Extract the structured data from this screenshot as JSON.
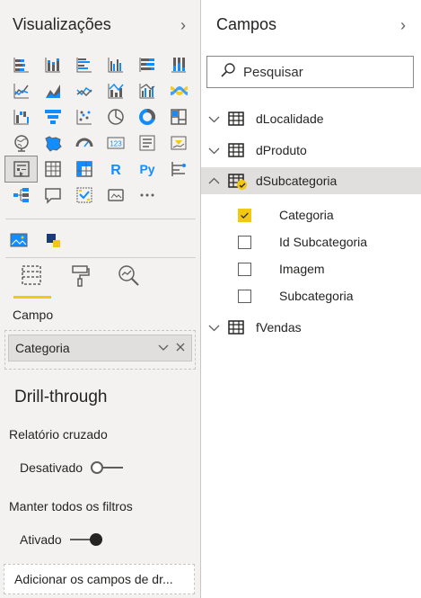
{
  "visualizations": {
    "title": "Visualizações",
    "tabs": [
      {
        "name": "fields-tab",
        "icon": "fields-well-icon"
      },
      {
        "name": "format-tab",
        "icon": "paint-roller-icon"
      },
      {
        "name": "analytics-tab",
        "icon": "analytics-magnifier-icon"
      }
    ],
    "field_section_label": "Campo",
    "field_value": "Categoria",
    "drillthrough": {
      "title": "Drill-through",
      "cross_report_label": "Relatório cruzado",
      "cross_report_state": "Desativado",
      "keep_filters_label": "Manter todos os filtros",
      "keep_filters_state": "Ativado",
      "add_fields_label": "Adicionar os campos de dr..."
    },
    "accent_color": "#f2c811"
  },
  "fields": {
    "title": "Campos",
    "search_placeholder": "Pesquisar",
    "tables": [
      {
        "name": "dLocalidade",
        "expanded": false
      },
      {
        "name": "dProduto",
        "expanded": false
      },
      {
        "name": "dSubcategoria",
        "expanded": true,
        "selected": true,
        "fields": [
          {
            "name": "Categoria",
            "checked": true
          },
          {
            "name": "Id Subcategoria",
            "checked": false
          },
          {
            "name": "Imagem",
            "checked": false
          },
          {
            "name": "Subcategoria",
            "checked": false
          }
        ]
      },
      {
        "name": "fVendas",
        "expanded": false
      }
    ]
  }
}
